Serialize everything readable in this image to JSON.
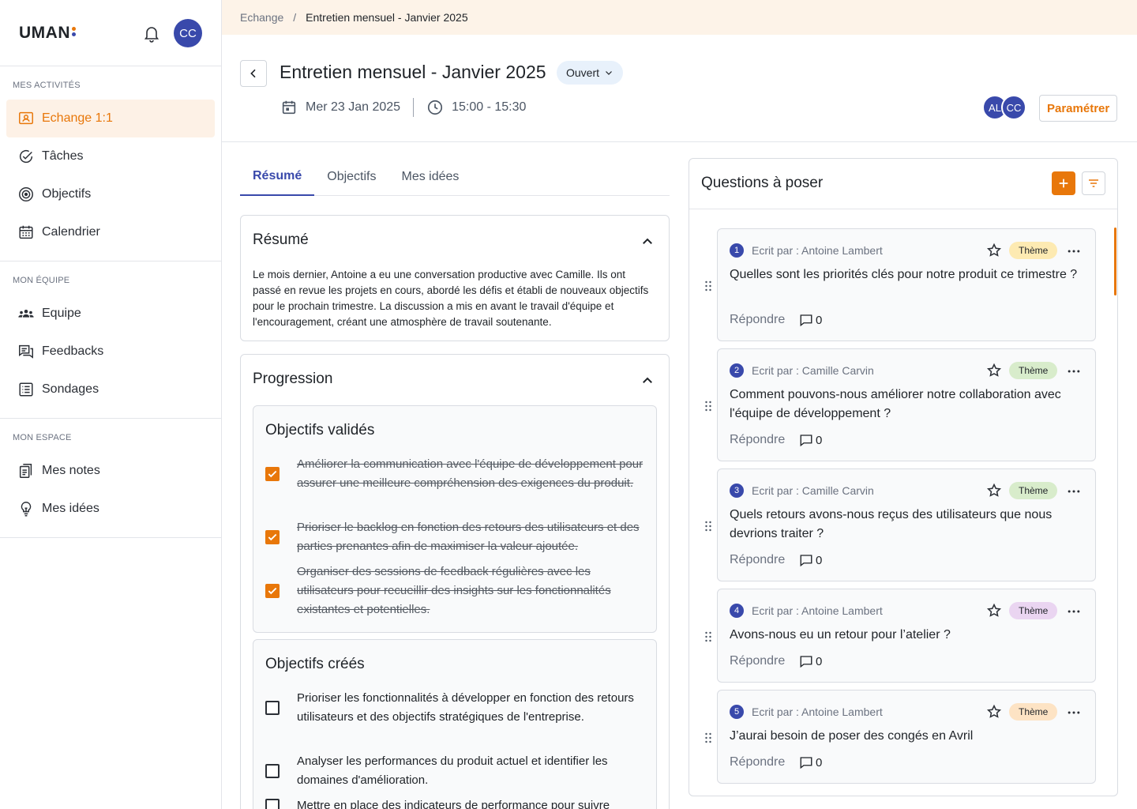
{
  "app": {
    "logo": "UMAN",
    "logo_dot_colors": [
      "#e8770a",
      "#3949ab"
    ],
    "user_initials": "CC"
  },
  "sidebar": {
    "sections": [
      {
        "title": "MES ACTIVITÉS",
        "items": [
          {
            "label": "Echange 1:1",
            "icon": "person-card-icon",
            "active": true
          },
          {
            "label": "Tâches",
            "icon": "check-circle-icon"
          },
          {
            "label": "Objectifs",
            "icon": "target-icon"
          },
          {
            "label": "Calendrier",
            "icon": "calendar-icon"
          }
        ]
      },
      {
        "title": "MON ÉQUIPE",
        "items": [
          {
            "label": "Equipe",
            "icon": "team-icon"
          },
          {
            "label": "Feedbacks",
            "icon": "chat-icon"
          },
          {
            "label": "Sondages",
            "icon": "list-icon"
          }
        ]
      },
      {
        "title": "MON ESPACE",
        "items": [
          {
            "label": "Mes notes",
            "icon": "notes-icon"
          },
          {
            "label": "Mes idées",
            "icon": "lightbulb-icon"
          }
        ]
      }
    ]
  },
  "breadcrumb": {
    "parent": "Echange",
    "separator": "/",
    "current": "Entretien mensuel - Janvier 2025"
  },
  "header": {
    "title": "Entretien mensuel - Janvier 2025",
    "status": "Ouvert",
    "date": "Mer 23 Jan 2025",
    "time": "15:00 - 15:30",
    "participants": [
      "AL",
      "CC"
    ],
    "settings_label": "Paramétrer"
  },
  "tabs": [
    {
      "label": "Résumé",
      "active": true
    },
    {
      "label": "Objectifs"
    },
    {
      "label": "Mes idées"
    }
  ],
  "summary": {
    "title": "Résumé",
    "text": "Le mois dernier, Antoine a eu une conversation productive avec Camille. Ils ont passé en revue les projets en cours, abordé les défis et établi de nouveaux objectifs pour le prochain trimestre. La discussion a mis en avant le travail d'équipe et l'encouragement, créant une atmosphère de travail soutenante."
  },
  "progress": {
    "title": "Progression",
    "validated": {
      "title": "Objectifs validés",
      "items": [
        {
          "text": "Améliorer la communication avec l'équipe de développement pour assurer une meilleure compréhension des exigences du produit.",
          "checked": true
        },
        {
          "text": "Prioriser le backlog en fonction des retours des utilisateurs et des parties prenantes afin de maximiser la valeur ajoutée.",
          "checked": true
        },
        {
          "text": "Organiser des sessions de feedback régulières avec les utilisateurs pour recueillir des insights sur les fonctionnalités existantes et potentielles.",
          "checked": true
        }
      ]
    },
    "created": {
      "title": "Objectifs créés",
      "items": [
        {
          "text": "Prioriser les fonctionnalités à développer en fonction des retours utilisateurs et des objectifs stratégiques de l'entreprise.",
          "checked": false
        },
        {
          "text": "Analyser les performances du produit actuel et identifier les domaines d'amélioration.",
          "checked": false
        },
        {
          "text": "Mettre en place des indicateurs de performance pour suivre",
          "checked": false
        }
      ]
    }
  },
  "questions": {
    "title": "Questions à poser",
    "reply_label": "Répondre",
    "items": [
      {
        "num": "1",
        "author": "Ecrit par : Antoine Lambert",
        "theme": "Thème",
        "theme_color": "#fdeab2",
        "text": "Quelles sont les priorités clés pour notre produit ce trimestre ?",
        "comments": "0"
      },
      {
        "num": "2",
        "author": "Ecrit par : Camille Carvin",
        "theme": "Thème",
        "theme_color": "#d8eccb",
        "text": "Comment pouvons-nous améliorer notre collaboration avec l'équipe de développement ?",
        "comments": "0"
      },
      {
        "num": "3",
        "author": "Ecrit par : Camille Carvin",
        "theme": "Thème",
        "theme_color": "#d8eccb",
        "text": "Quels retours avons-nous reçus des utilisateurs que nous devrions traiter ?",
        "comments": "0"
      },
      {
        "num": "4",
        "author": "Ecrit par : Antoine Lambert",
        "theme": "Thème",
        "theme_color": "#ead5f1",
        "text": "Avons-nous eu un retour pour l’atelier ?",
        "comments": "0"
      },
      {
        "num": "5",
        "author": "Ecrit par : Antoine Lambert",
        "theme": "Thème",
        "theme_color": "#fde3c4",
        "text": "J’aurai besoin de poser des congés en Avril",
        "comments": "0"
      }
    ]
  }
}
